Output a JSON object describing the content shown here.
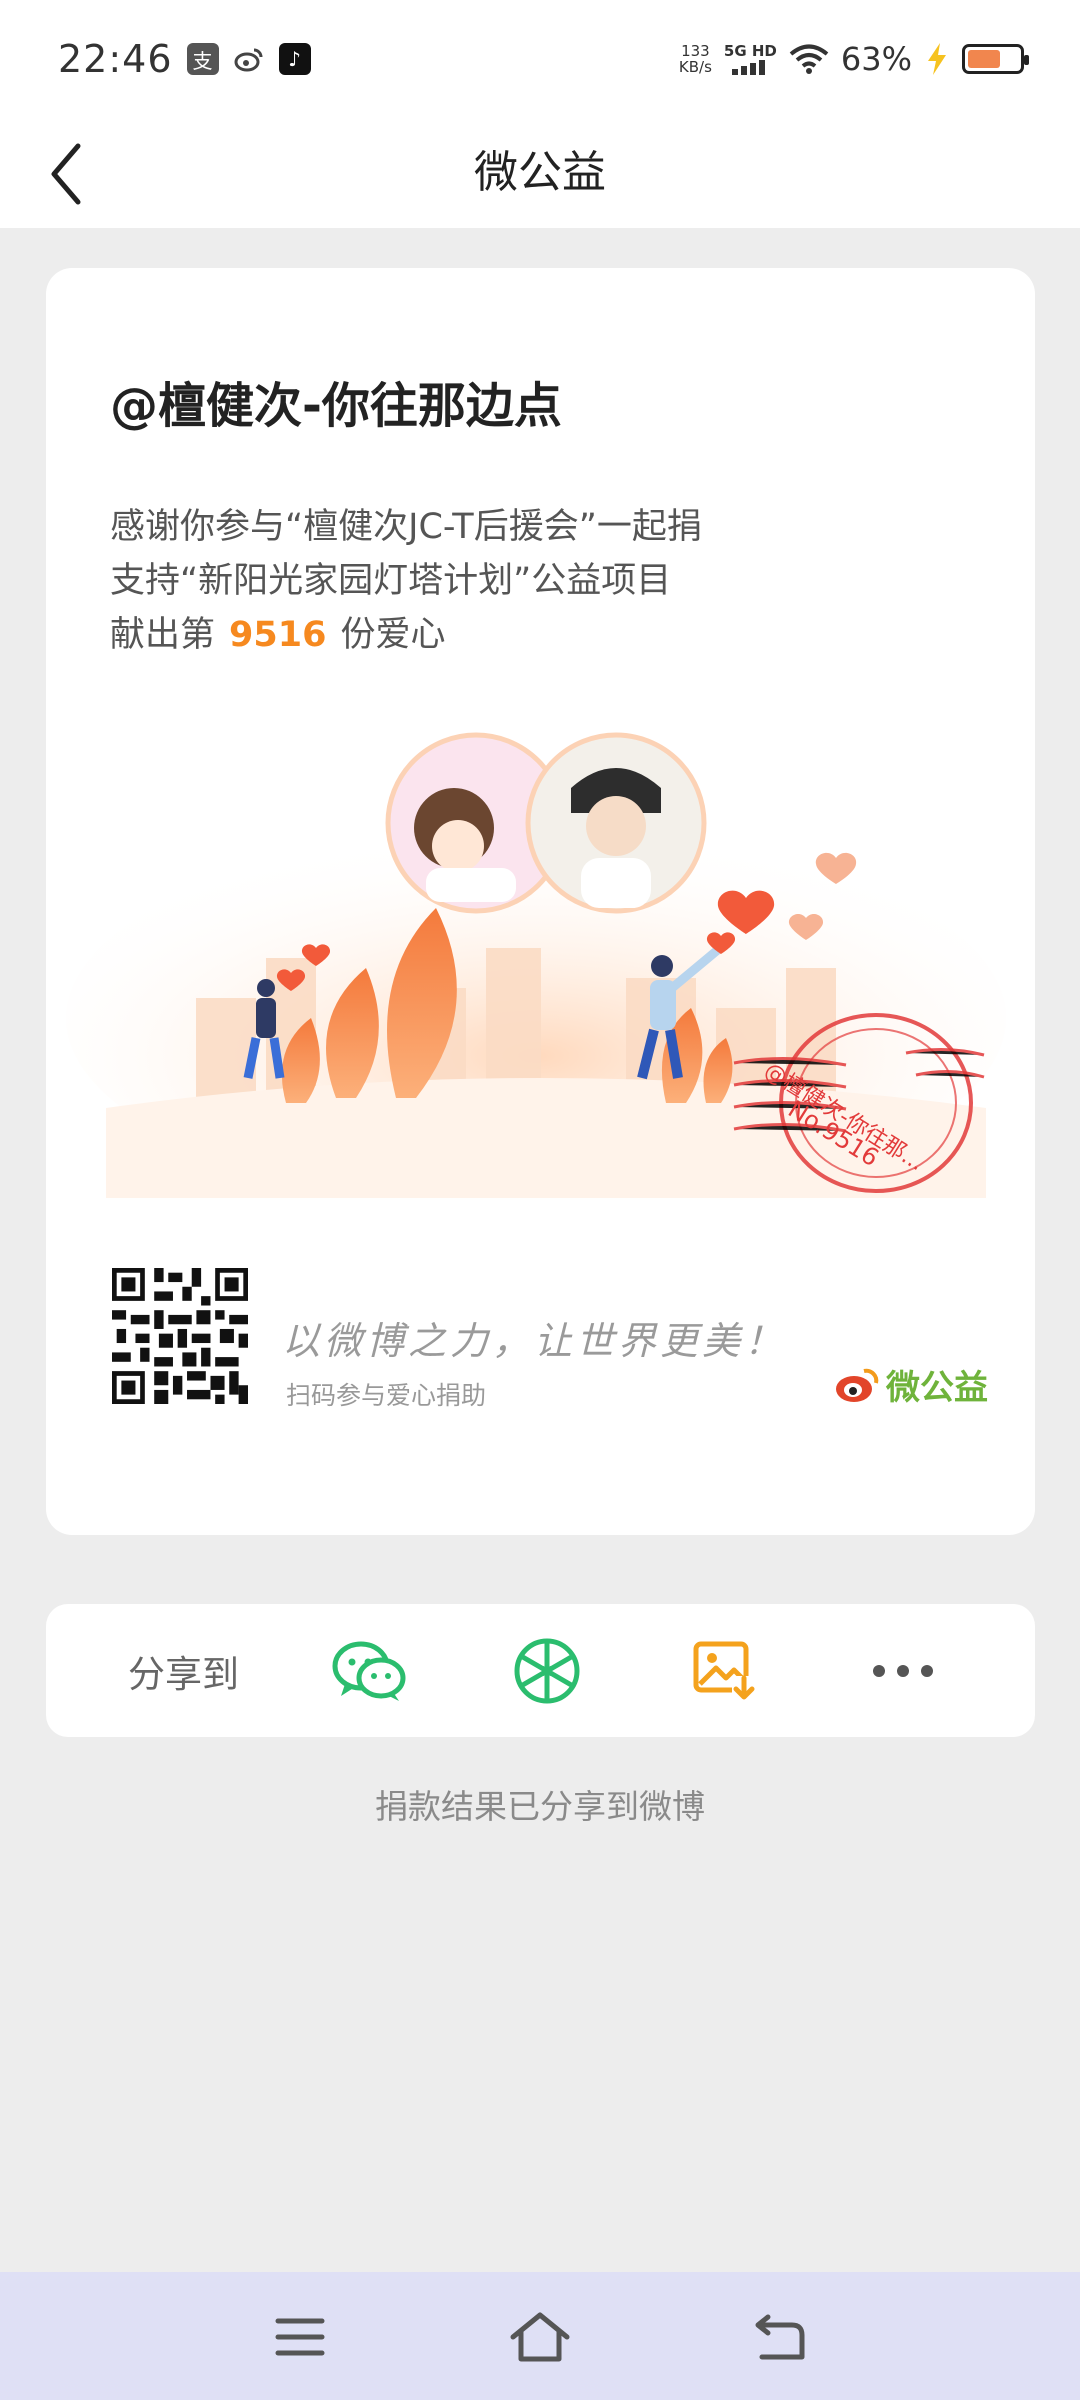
{
  "status_bar": {
    "time": "22:46",
    "net_speed_value": "133",
    "net_speed_unit": "KB/s",
    "network": "5G HD",
    "battery": "63%"
  },
  "header": {
    "title": "微公益",
    "back_icon": "chevron-left-icon"
  },
  "card": {
    "user": "@檀健次-你往那边点",
    "message_line1": "感谢你参与“檀健次JC-T后援会”一起捐",
    "message_line2": "支持“新阳光家园灯塔计划”公益项目",
    "message_line3_prefix": "献出第",
    "count": "9516",
    "message_line3_suffix": "份爱心",
    "stamp_name": "@檀健次-你往那...",
    "stamp_no": "No.9516",
    "slogan": "以微博之力，让世界更美！",
    "scan_hint": "扫码参与爱心捐助",
    "brand": "微公益",
    "brand_color": "#6fb33b",
    "accent": "#f6891f"
  },
  "share": {
    "label": "分享到",
    "items": [
      "wechat-icon",
      "moments-icon",
      "save-image-icon",
      "more-icon"
    ]
  },
  "share_status": "捐款结果已分享到微博",
  "nav": {
    "items": [
      "menu-icon",
      "home-icon",
      "back-icon"
    ]
  }
}
